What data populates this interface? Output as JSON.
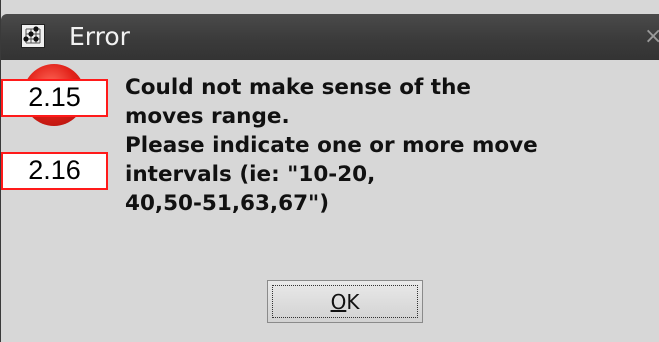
{
  "window": {
    "title": "Error",
    "close_glyph": "×",
    "app_icon": "go-board-icon"
  },
  "icon": {
    "name": "error-icon",
    "color": "#e2231a"
  },
  "annotations": [
    {
      "label": "2.15",
      "border_color": "#ff1a1a"
    },
    {
      "label": "2.16",
      "border_color": "#ff1a1a"
    }
  ],
  "message": {
    "lines": [
      "Could not make sense of the",
      "moves range.",
      "Please indicate one or more move",
      "intervals (ie: \"10-20,",
      "40,50-51,63,67\")"
    ]
  },
  "buttons": {
    "ok": {
      "mnemonic": "O",
      "rest": "K"
    }
  }
}
